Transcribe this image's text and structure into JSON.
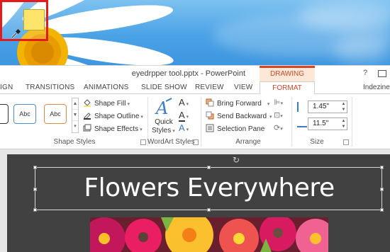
{
  "window": {
    "title": "eyedrpper tool.pptx - PowerPoint",
    "contextual_group": "DRAWING TOOLS",
    "help": "?",
    "account": "Indezine"
  },
  "tabs": [
    {
      "label": "IGN"
    },
    {
      "label": "TRANSITIONS"
    },
    {
      "label": "ANIMATIONS"
    },
    {
      "label": "SLIDE SHOW"
    },
    {
      "label": "REVIEW"
    },
    {
      "label": "VIEW"
    },
    {
      "label": "FORMAT",
      "active": true
    }
  ],
  "eyedropper": {
    "sampled_color": "#fde46a",
    "highlight_color": "#e31b1b",
    "icon": "eyedropper-icon"
  },
  "ribbon": {
    "shape_styles": {
      "label": "Shape Styles",
      "thumbs": [
        "Abc",
        "Abc",
        "Abc"
      ],
      "fill": "Shape Fill",
      "outline": "Shape Outline",
      "effects": "Shape Effects"
    },
    "wordart_styles": {
      "label": "WordArt Styles",
      "quick_styles_line1": "Quick",
      "quick_styles_line2": "Styles"
    },
    "arrange": {
      "label": "Arrange",
      "bring_forward": "Bring Forward",
      "send_backward": "Send Backward",
      "selection_pane": "Selection Pane"
    },
    "size": {
      "label": "Size",
      "height": "1.45\"",
      "width": "11.5\""
    }
  },
  "slide": {
    "title": "Flowers Everywhere"
  },
  "colors": {
    "accent": "#d24726",
    "slide_background": "#414141"
  }
}
